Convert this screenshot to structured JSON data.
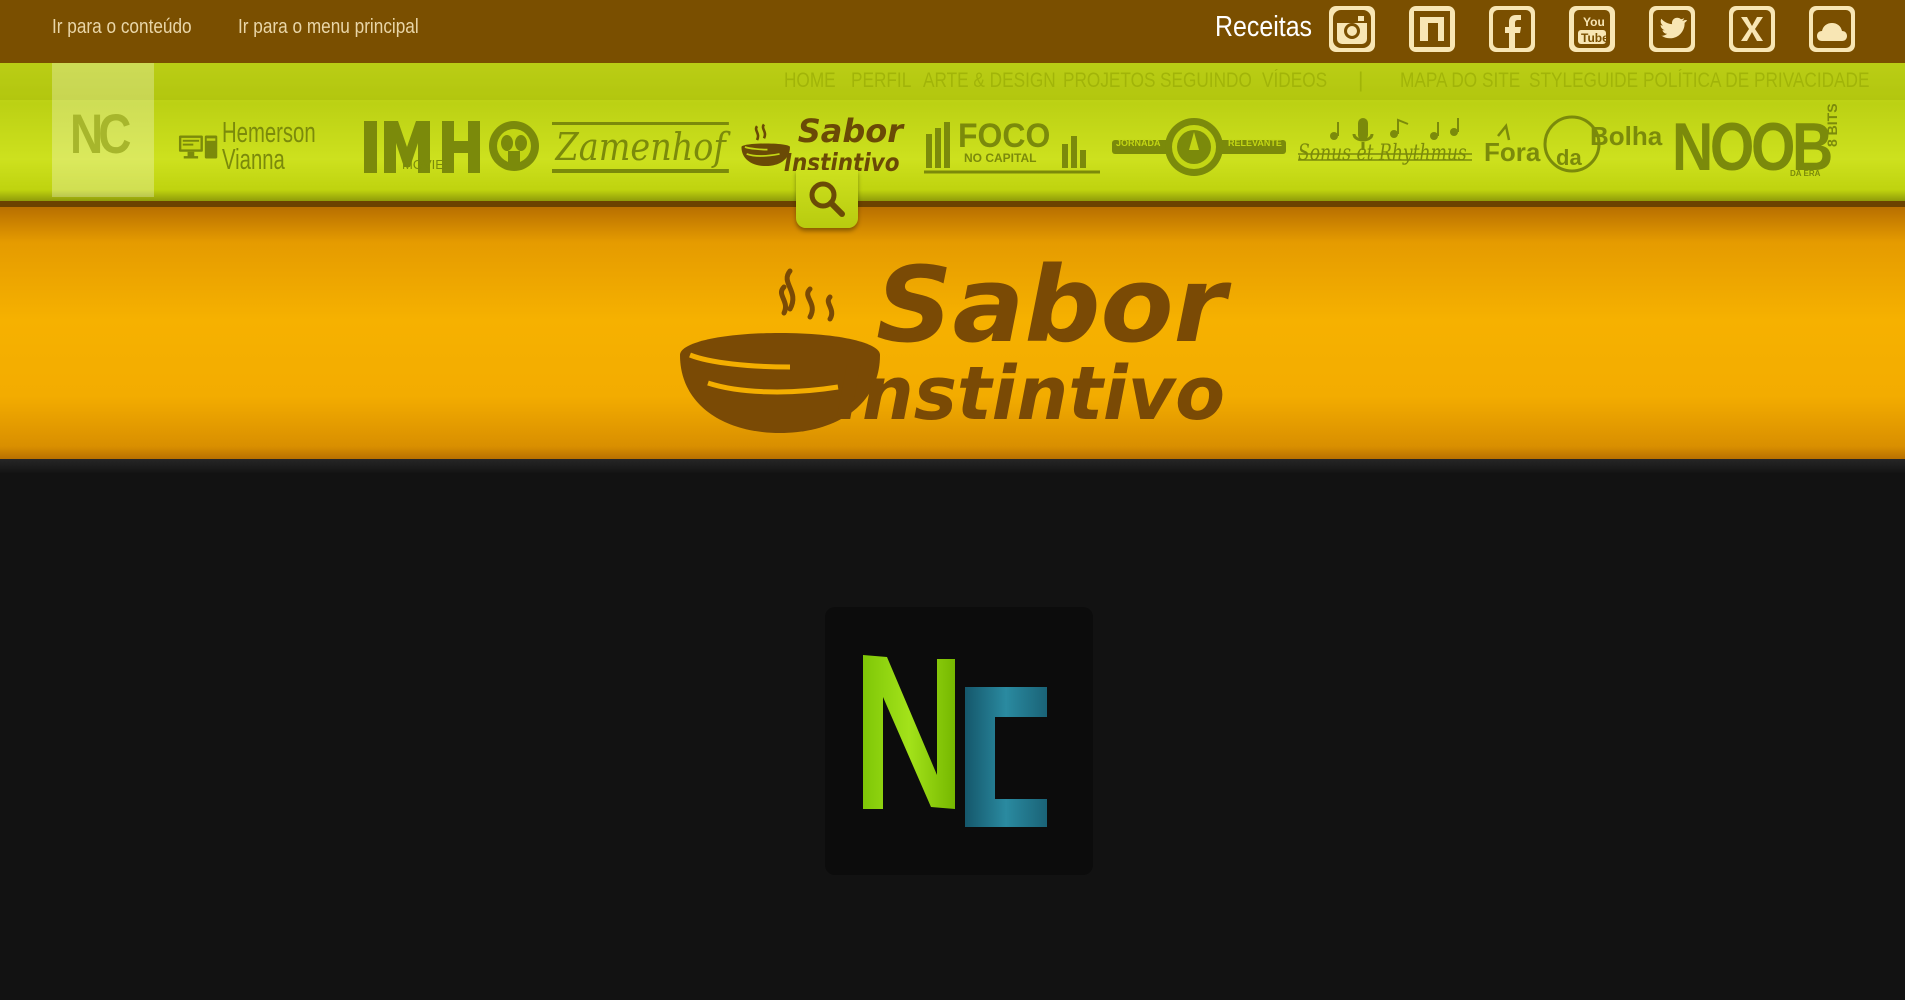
{
  "skip_links": [
    "Ir para o conteúdo",
    "Ir para o menu principal"
  ],
  "category_label": "Receitas",
  "social_icons": [
    "instagram-icon",
    "flipboard-icon",
    "facebook-icon",
    "youtube-icon",
    "twitter-icon",
    "xing-icon",
    "soundcloud-icon"
  ],
  "youtube_text": [
    "You",
    "Tube"
  ],
  "nav_primary": [
    "HOME",
    "PERFIL",
    "ARTE & DESIGN",
    "PROJETOS",
    "SEGUINDO",
    "VÍDEOS"
  ],
  "nav_separator": "|",
  "nav_secondary": [
    "MAPA DO SITE",
    "STYLEGUIDE",
    "POLÍTICA DE PRIVACIDADE"
  ],
  "brand_mark": "NC",
  "site_logos": {
    "hemerson": [
      "Hemerson",
      "Vianna"
    ],
    "imh": [
      "IMH",
      "MOVIES"
    ],
    "zamenhof": "Zamenhof",
    "sabor": [
      "Sabor",
      "Instintivo"
    ],
    "foco": [
      "FOCO",
      "NO CAPITAL"
    ],
    "jornada": [
      "JORNADA",
      "RELEVANTE"
    ],
    "sonus": "Sonus et Rhythmus",
    "fora": [
      "Fora",
      "da",
      "Bolha"
    ],
    "noob": [
      "NOOB",
      "8 BITS",
      "DA ERA"
    ]
  },
  "banner": {
    "line1": "Sabor",
    "line2": "Instintivo"
  },
  "loader_mark": {
    "letter1": "N",
    "letter2": "C"
  },
  "colors": {
    "topbar": "#7a4f00",
    "nav_green": "#c8dc1e",
    "banner_orange": "#f6b100",
    "logo_brown": "#7a4a05",
    "loader_green": "#8cd10a",
    "loader_teal": "#1f6d80"
  }
}
